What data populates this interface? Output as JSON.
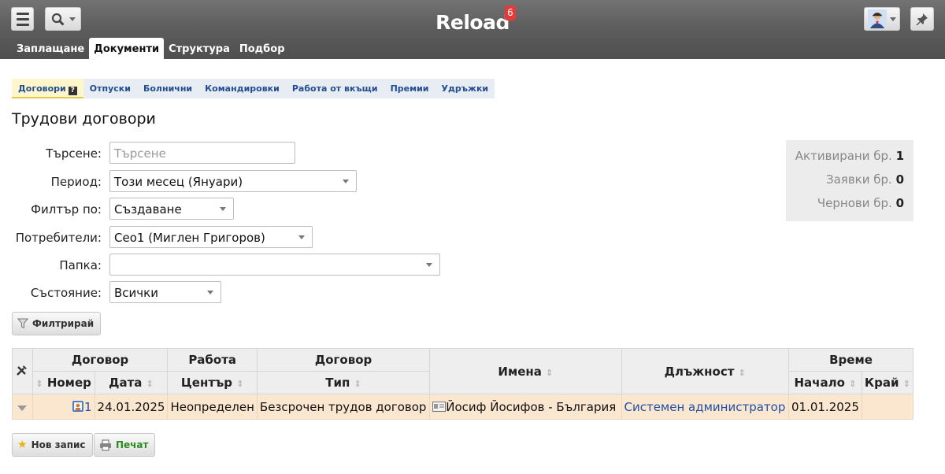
{
  "app": {
    "title": "Reload",
    "badge": "6"
  },
  "main_tabs": [
    {
      "label": "Заплащане"
    },
    {
      "label": "Документи",
      "active": true
    },
    {
      "label": "Структура"
    },
    {
      "label": "Подбор"
    }
  ],
  "sub_tabs": [
    {
      "label": "Договори",
      "active": true,
      "help": "?"
    },
    {
      "label": "Отпуски"
    },
    {
      "label": "Болнични"
    },
    {
      "label": "Командировки"
    },
    {
      "label": "Работа от вкъщи"
    },
    {
      "label": "Премии"
    },
    {
      "label": "Удръжки"
    }
  ],
  "page": {
    "title": "Трудови договори"
  },
  "filters": {
    "search": {
      "label": "Търсене:",
      "placeholder": "Търсене",
      "value": ""
    },
    "period": {
      "label": "Период:",
      "value": "Този месец (Януари)"
    },
    "filter_by": {
      "label": "Филтър по:",
      "value": "Създаване"
    },
    "users": {
      "label": "Потребители:",
      "value": "Ceo1 (Миглен Григоров)"
    },
    "folder": {
      "label": "Папка:",
      "value": ""
    },
    "status": {
      "label": "Състояние:",
      "value": "Всички"
    },
    "filter_button": "Филтрирай"
  },
  "stats": [
    {
      "label": "Активирани бр.",
      "value": "1"
    },
    {
      "label": "Заявки бр.",
      "value": "0"
    },
    {
      "label": "Чернови бр.",
      "value": "0"
    }
  ],
  "table": {
    "group_headers": {
      "contract": "Договор",
      "work": "Работа",
      "contract2": "Договор",
      "names": "Имена",
      "position": "Длъжност",
      "time": "Време"
    },
    "sub_headers": {
      "number": "Номер",
      "date": "Дата",
      "center": "Център",
      "type": "Тип",
      "start": "Начало",
      "end": "Край"
    },
    "rows": [
      {
        "number": "1",
        "date": "24.01.2025",
        "center": "Неопределен",
        "type": "Безсрочен трудов договор",
        "name": "Йосиф Йосифов - България",
        "position": "Системен администратор",
        "start": "01.01.2025",
        "end": ""
      }
    ]
  },
  "actions": {
    "new_record": "Нов запис",
    "print": "Печат"
  },
  "colors": {
    "accent": "#224d91",
    "row_highlight": "#fbe6cf",
    "badge": "#e43a3a",
    "print_green": "#2a8a1e"
  }
}
